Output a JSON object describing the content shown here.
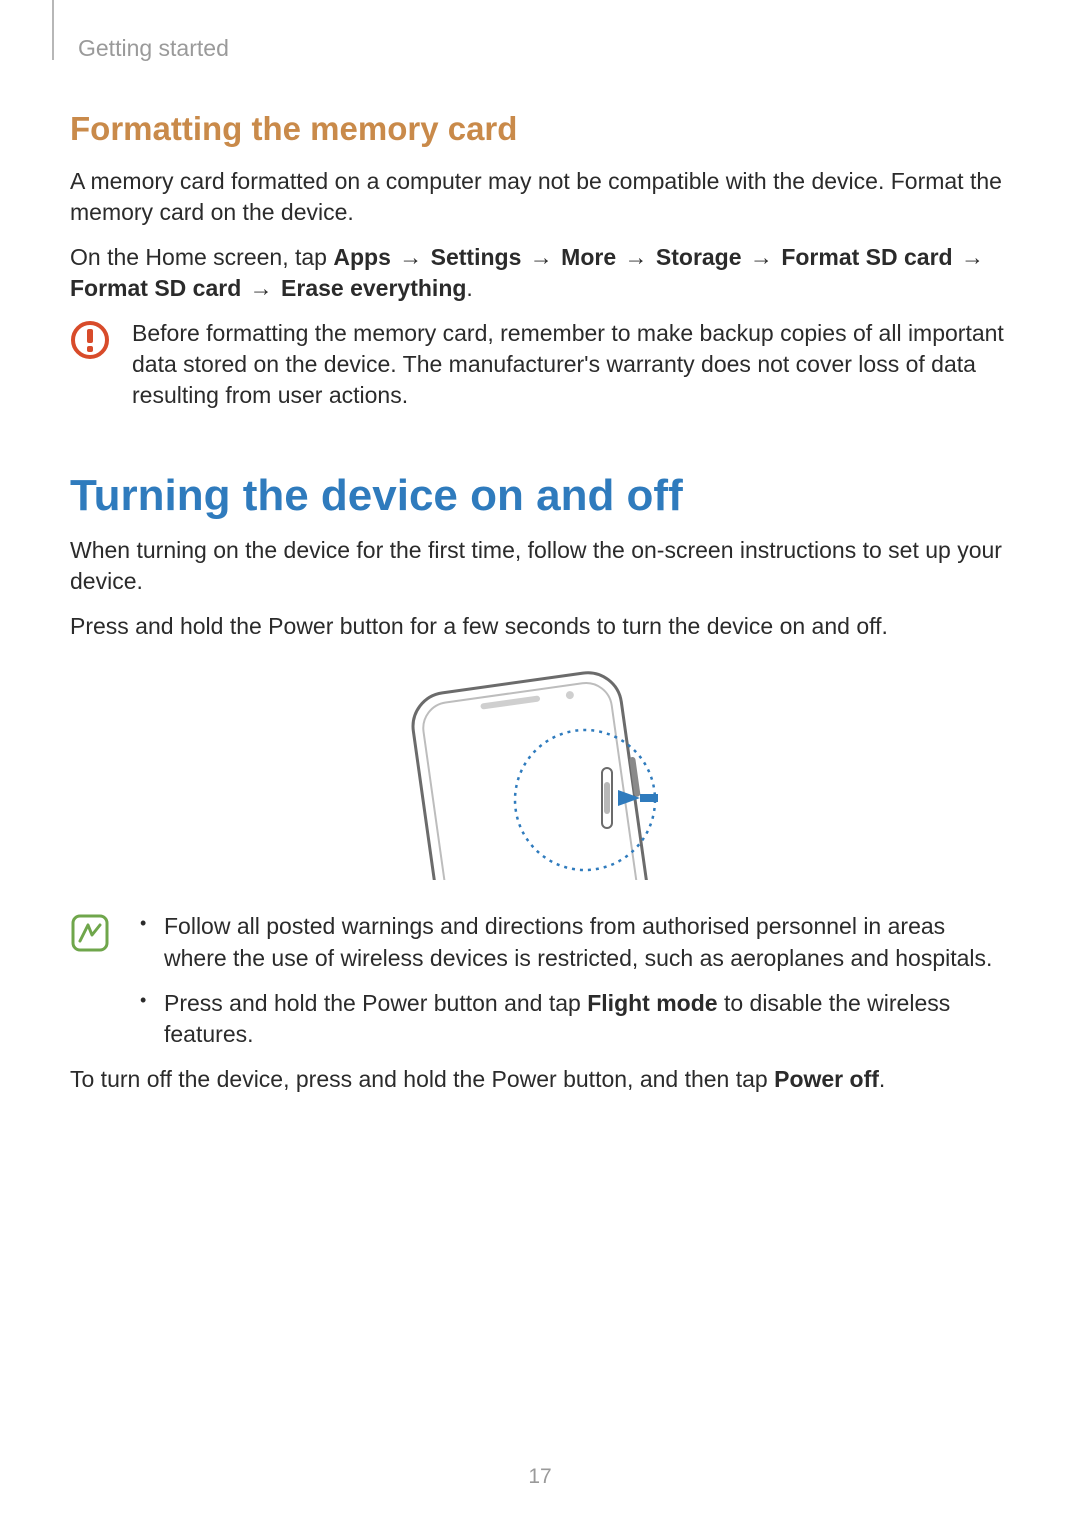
{
  "header": {
    "section": "Getting started"
  },
  "section1": {
    "heading": "Formatting the memory card",
    "p1": "A memory card formatted on a computer may not be compatible with the device. Format the memory card on the device.",
    "p2_lead": "On the Home screen, tap ",
    "path": [
      "Apps",
      "Settings",
      "More",
      "Storage",
      "Format SD card",
      "Format SD card",
      "Erase everything"
    ],
    "arrow": "→",
    "warning": "Before formatting the memory card, remember to make backup copies of all important data stored on the device. The manufacturer's warranty does not cover loss of data resulting from user actions."
  },
  "section2": {
    "heading": "Turning the device on and off",
    "p1": "When turning on the device for the first time, follow the on-screen instructions to set up your device.",
    "p2": "Press and hold the Power button for a few seconds to turn the device on and off.",
    "notes": {
      "item1": "Follow all posted warnings and directions from authorised personnel in areas where the use of wireless devices is restricted, such as aeroplanes and hospitals.",
      "item2_a": "Press and hold the Power button and tap ",
      "item2_bold": "Flight mode",
      "item2_b": " to disable the wireless features."
    },
    "p3_a": "To turn off the device, press and hold the Power button, and then tap ",
    "p3_bold": "Power off",
    "p3_b": "."
  },
  "page_number": "17"
}
